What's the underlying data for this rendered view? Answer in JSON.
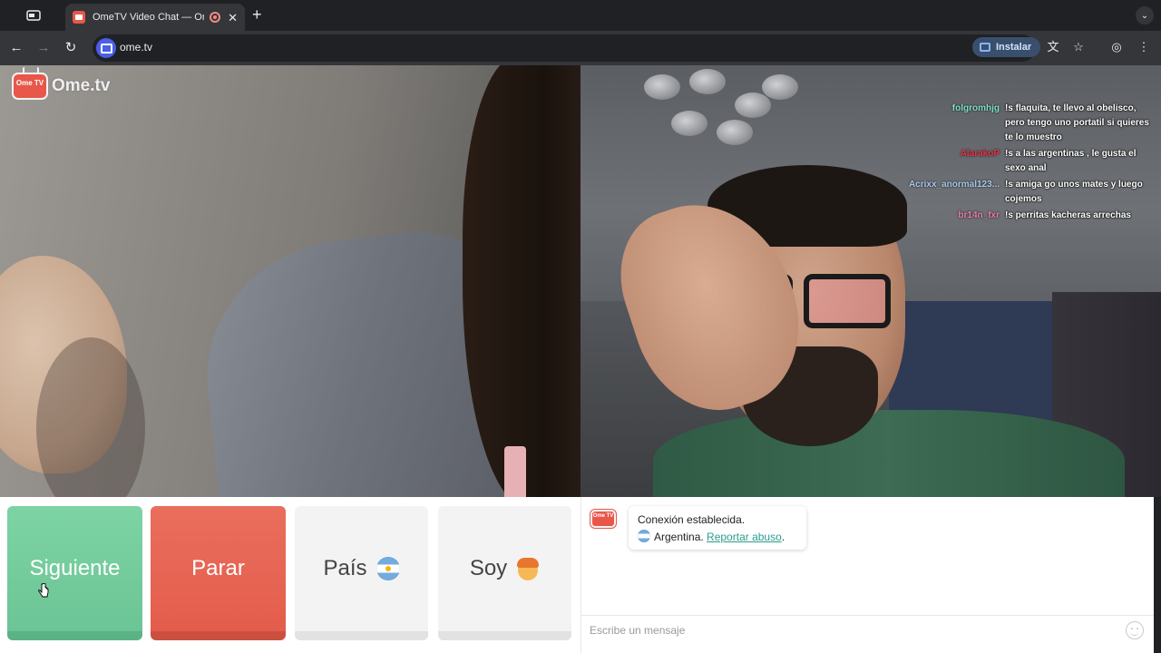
{
  "browser": {
    "tab_title": "OmeTV Video Chat — Omegle",
    "url": "ome.tv",
    "install_label": "Instalar"
  },
  "site": {
    "logo_tv_text": "Ome TV",
    "logo_text": "Ome.tv"
  },
  "chat_overlay": [
    {
      "user": "folgromhjg",
      "color": "#7fe0c8",
      "text": "!s flaquita, te llevo al obelisco, pero tengo uno portatil si quieres te lo muestro"
    },
    {
      "user": "AlarakoP",
      "color": "#e8344a",
      "text": "!s a las argentinas , le gusta el sexo anal"
    },
    {
      "user": "Acrixx_anormal123...",
      "color": "#a9c9ee",
      "text": "!s amiga go unos mates y luego cojemos"
    },
    {
      "user": "br14n_fxr",
      "color": "#ea7fa7",
      "text": "!s perritas kacheras arrechas"
    }
  ],
  "controls": {
    "next_label": "Siguiente",
    "stop_label": "Parar",
    "country_label": "País",
    "gender_label": "Soy"
  },
  "chat": {
    "system_line1": "Conexión establecida.",
    "country": "Argentina.",
    "report_label": "Reportar abuso",
    "report_suffix": ".",
    "placeholder": "Escribe un mensaje"
  }
}
